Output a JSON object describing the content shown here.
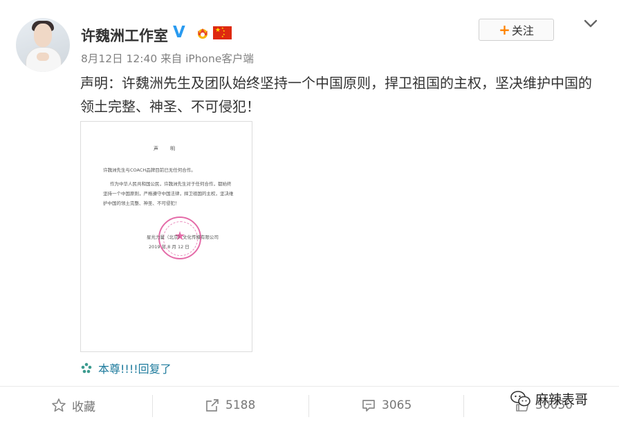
{
  "header": {
    "username": "许魏洲工作室",
    "verified_badge": "V",
    "timestamp": "8月12日 12:40",
    "source_prefix": "来自",
    "source": "iPhone客户端",
    "follow_label": "关注",
    "icons": [
      "crown-badge-icon",
      "china-flag-icon",
      "chevron-down-icon"
    ]
  },
  "post": {
    "text": "声明：许魏洲先生及团队始终坚持一个中国原则，捍卫祖国的主权，坚决维护中国的领土完整、神圣、不可侵犯！"
  },
  "document": {
    "title": "声　　明",
    "line1": "许魏洲先生与COACH品牌目前已无任何合作。",
    "line2": "作为中华人民共和国公民，许魏洲先生对于任何合作，都始终",
    "line3": "坚持一个中国原则，严格遵守中国法律，捍卫祖国的主权，坚决维",
    "line4": "护中国的领土完整、神圣、不可侵犯！",
    "signature": "星光力量（北京）文化传媒有限公司",
    "date": "2019 年 8 月 12 日"
  },
  "reply": {
    "text": "本尊!!!!回复了",
    "icon": "weibo-reply-icon"
  },
  "actions": {
    "favorite_label": "收藏",
    "repost_count": "5188",
    "comment_count": "3065",
    "like_count": "30050"
  },
  "watermark": {
    "text": "麻辣表哥",
    "icon": "wechat-icon"
  }
}
